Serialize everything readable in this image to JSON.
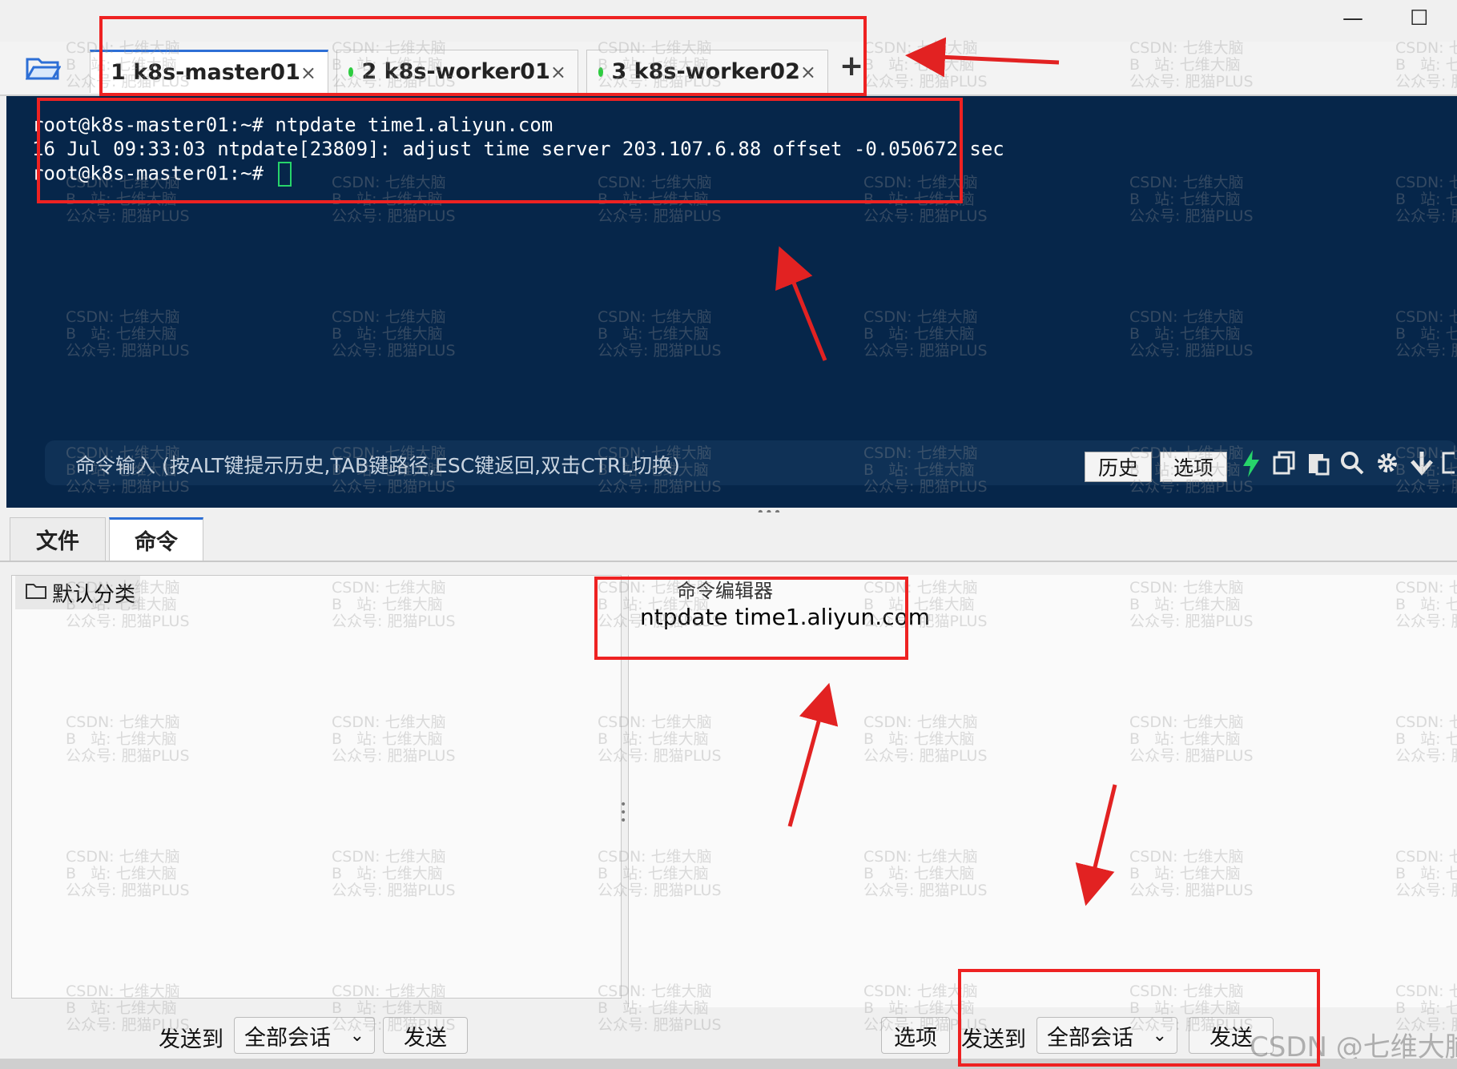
{
  "window": {
    "minimize_glyph": "—",
    "maximize_glyph": "☐"
  },
  "tabs": [
    {
      "label": "1 k8s-master01",
      "active": true
    },
    {
      "label": "2 k8s-worker01",
      "active": false
    },
    {
      "label": "3 k8s-worker02",
      "active": false
    }
  ],
  "tab_close_glyph": "×",
  "add_tab_glyph": "+",
  "terminal": {
    "lines": [
      "root@k8s-master01:~# ntpdate time1.aliyun.com",
      "16 Jul 09:33:03 ntpdate[23809]: adjust time server 203.107.6.88 offset -0.050672 sec",
      "root@k8s-master01:~#"
    ],
    "bg_color": "#06264a",
    "cursor_color": "#27d46a"
  },
  "command_bar": {
    "hint": "命令输入 (按ALT键提示历史,TAB键路径,ESC键返回,双击CTRL切换)",
    "history_button": "历史",
    "options_button": "选项",
    "icons": [
      "lightning-icon",
      "copy-icon",
      "paste-icon",
      "search-icon",
      "gear-icon",
      "download-icon",
      "window-icon"
    ]
  },
  "bottom_tabs": [
    {
      "label": "文件",
      "active": false
    },
    {
      "label": "命令",
      "active": true
    }
  ],
  "left_panel": {
    "folder_label": "默认分类",
    "send_to_label": "发送到",
    "target_select": "全部会话",
    "send_button": "发送"
  },
  "editor": {
    "title": "命令编辑器",
    "content": "ntpdate time1.aliyun.com",
    "options_button": "选项",
    "send_to_label": "发送到",
    "target_select": "全部会话",
    "send_button": "发送"
  },
  "watermark": {
    "line1": "CSDN: 七维大脑",
    "line2": "B   站: 七维大脑",
    "line3": "公众号: 肥猫PLUS",
    "footer": "CSDN @七维大脑"
  },
  "annotation_color": "#e22222"
}
